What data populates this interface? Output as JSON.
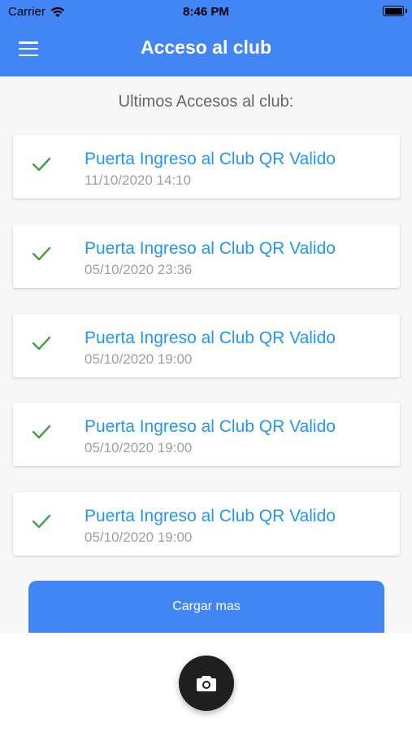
{
  "status_bar": {
    "carrier": "Carrier",
    "time": "8:46 PM"
  },
  "header": {
    "title": "Acceso al club",
    "menu_icon": "menu-icon"
  },
  "subtitle": "Ultimos Accesos al club:",
  "accesses": [
    {
      "title": "Puerta Ingreso al Club QR Valido",
      "date": "11/10/2020 14:10",
      "status_icon": "check-icon"
    },
    {
      "title": "Puerta Ingreso al Club QR Valido",
      "date": "05/10/2020 23:36",
      "status_icon": "check-icon"
    },
    {
      "title": "Puerta Ingreso al Club QR Valido",
      "date": "05/10/2020 19:00",
      "status_icon": "check-icon"
    },
    {
      "title": "Puerta Ingreso al Club QR Valido",
      "date": "05/10/2020 19:00",
      "status_icon": "check-icon"
    },
    {
      "title": "Puerta Ingreso al Club QR Valido",
      "date": "05/10/2020 19:00",
      "status_icon": "check-icon"
    }
  ],
  "load_more_label": "Cargar mas",
  "camera_button_icon": "camera-icon",
  "colors": {
    "primary": "#4285f4",
    "link_text": "#2196f3",
    "check": "#43a047",
    "fab": "#1f1f1f"
  }
}
